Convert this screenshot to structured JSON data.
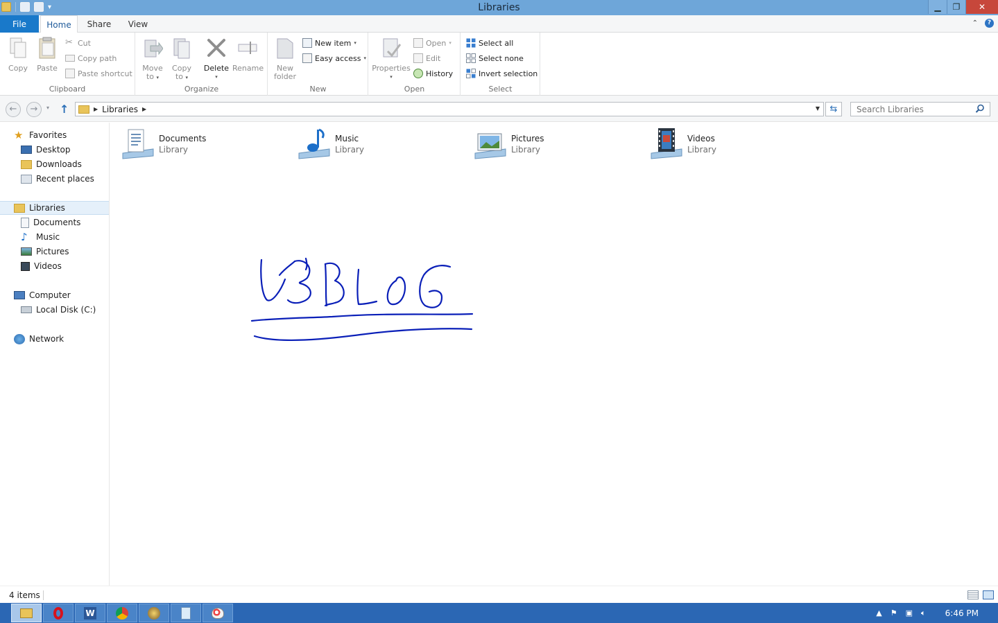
{
  "window": {
    "title": "Libraries"
  },
  "tabs": {
    "file": "File",
    "home": "Home",
    "share": "Share",
    "view": "View"
  },
  "ribbon": {
    "clipboard": {
      "label": "Clipboard",
      "copy": "Copy",
      "paste": "Paste",
      "cut": "Cut",
      "copy_path": "Copy path",
      "paste_shortcut": "Paste shortcut"
    },
    "organize": {
      "label": "Organize",
      "move_to_1": "Move",
      "move_to_2": "to",
      "copy_to_1": "Copy",
      "copy_to_2": "to",
      "delete": "Delete",
      "rename": "Rename"
    },
    "new": {
      "label": "New",
      "new_folder_1": "New",
      "new_folder_2": "folder",
      "new_item": "New item",
      "easy_access": "Easy access"
    },
    "open": {
      "label": "Open",
      "properties": "Properties",
      "open": "Open",
      "edit": "Edit",
      "history": "History"
    },
    "select": {
      "label": "Select",
      "select_all": "Select all",
      "select_none": "Select none",
      "invert_selection": "Invert selection"
    }
  },
  "address": {
    "crumb": "Libraries",
    "search_placeholder": "Search Libraries"
  },
  "nav": {
    "favorites": "Favorites",
    "desktop": "Desktop",
    "downloads": "Downloads",
    "recent_places": "Recent places",
    "libraries": "Libraries",
    "documents": "Documents",
    "music": "Music",
    "pictures": "Pictures",
    "videos": "Videos",
    "computer": "Computer",
    "local_disk": "Local Disk (C:)",
    "network": "Network"
  },
  "libraries": [
    {
      "name": "Documents",
      "type": "Library"
    },
    {
      "name": "Music",
      "type": "Library"
    },
    {
      "name": "Pictures",
      "type": "Library"
    },
    {
      "name": "Videos",
      "type": "Library"
    }
  ],
  "status": {
    "count": "4 items"
  },
  "taskbar": {
    "clock": "6:46 PM"
  },
  "colors": {
    "accent": "#1979ca",
    "titlebar": "#6ea6d9",
    "taskbar": "#2b67b4",
    "scribble": "#0a1fb8"
  }
}
